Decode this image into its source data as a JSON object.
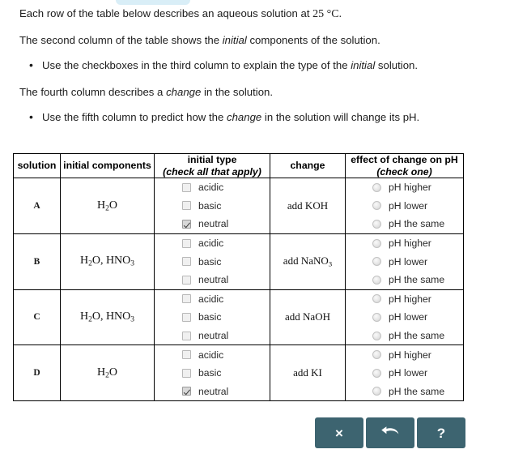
{
  "intro": {
    "line1_a": "Each row of the table below describes an aqueous solution at ",
    "line1_temp": "25 °C.",
    "line2_a": "The second column of the table shows the ",
    "line2_ital": "initial",
    "line2_b": " components of the solution.",
    "bullet1_a": "Use the checkboxes in the third column to explain the type of the ",
    "bullet1_ital": "initial",
    "bullet1_b": " solution.",
    "line3_a": "The fourth column describes a ",
    "line3_ital": "change",
    "line3_b": " in the solution.",
    "bullet2_a": "Use the fifth column to predict how the ",
    "bullet2_ital": "change",
    "bullet2_b": " in the solution will change its pH."
  },
  "table": {
    "headers": {
      "solution": "solution",
      "initial_components": "initial components",
      "initial_type_main": "initial type",
      "initial_type_sub": "(check all that apply)",
      "change": "change",
      "effect_main": "effect of change on pH",
      "effect_sub": "(check one)"
    },
    "checkbox_options": [
      "acidic",
      "basic",
      "neutral"
    ],
    "radio_options": [
      "pH higher",
      "pH lower",
      "pH the same"
    ],
    "rows": [
      {
        "solution": "A",
        "components": [
          {
            "text": "H",
            "sub": "2"
          },
          {
            "text": "O",
            "sub": ""
          }
        ],
        "components_plain": "H2O",
        "checked": {
          "acidic": false,
          "basic": false,
          "neutral": true
        },
        "change": [
          {
            "text": "add KOH",
            "sub": ""
          }
        ],
        "change_plain": "add KOH",
        "selected_effect": null
      },
      {
        "solution": "B",
        "components": [
          {
            "text": "H",
            "sub": "2"
          },
          {
            "text": "O, HNO",
            "sub": "3"
          }
        ],
        "components_plain": "H2O, HNO3",
        "checked": {
          "acidic": false,
          "basic": false,
          "neutral": false
        },
        "change": [
          {
            "text": "add NaNO",
            "sub": "3"
          }
        ],
        "change_plain": "add NaNO3",
        "selected_effect": null
      },
      {
        "solution": "C",
        "components": [
          {
            "text": "H",
            "sub": "2"
          },
          {
            "text": "O, HNO",
            "sub": "3"
          }
        ],
        "components_plain": "H2O, HNO3",
        "checked": {
          "acidic": false,
          "basic": false,
          "neutral": false
        },
        "change": [
          {
            "text": "add NaOH",
            "sub": ""
          }
        ],
        "change_plain": "add NaOH",
        "selected_effect": null
      },
      {
        "solution": "D",
        "components": [
          {
            "text": "H",
            "sub": "2"
          },
          {
            "text": "O",
            "sub": ""
          }
        ],
        "components_plain": "H2O",
        "checked": {
          "acidic": false,
          "basic": false,
          "neutral": true
        },
        "change": [
          {
            "text": "add KI",
            "sub": ""
          }
        ],
        "change_plain": "add KI",
        "selected_effect": null
      }
    ]
  },
  "buttons": [
    {
      "name": "clear-button",
      "icon": "close-icon",
      "label": "×"
    },
    {
      "name": "undo-button",
      "icon": "undo-arrow-icon",
      "label": ""
    },
    {
      "name": "help-button",
      "icon": "question-mark-icon",
      "label": "?"
    }
  ],
  "colors": {
    "button_teal": "#3d6470",
    "top_pill": "#d9eef7",
    "border": "#000000"
  }
}
